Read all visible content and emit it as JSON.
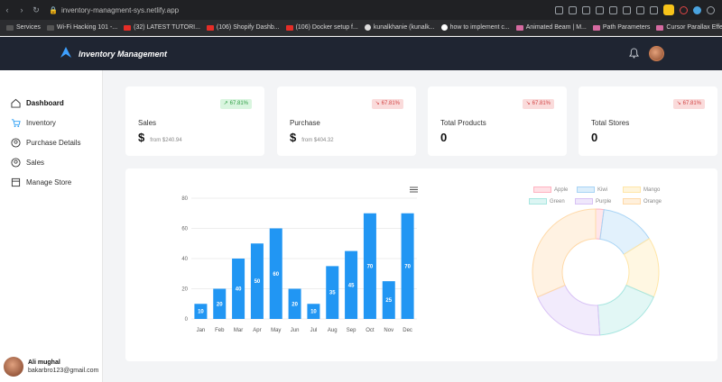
{
  "browser": {
    "url": "inventory-managment-sys.netlify.app"
  },
  "bookmarks": [
    {
      "label": "Services",
      "icon": "grid-icon"
    },
    {
      "label": "Wi-Fi Hacking 101 -...",
      "icon": "wifi-icon"
    },
    {
      "label": "(32) LATEST TUTORI...",
      "icon": "youtube-icon"
    },
    {
      "label": "(106) Shopify Dashb...",
      "icon": "youtube-icon"
    },
    {
      "label": "(106) Docker setup f...",
      "icon": "youtube-icon"
    },
    {
      "label": "kunalkhanie (kunalk...",
      "icon": "github-icon"
    },
    {
      "label": "how to implement c...",
      "icon": "google-icon"
    },
    {
      "label": "Animated Beam | M...",
      "icon": "app-icon"
    },
    {
      "label": "Path Parameters",
      "icon": "app-icon"
    },
    {
      "label": "Cursor Parallax Effect",
      "icon": "app-icon"
    }
  ],
  "header": {
    "title": "Inventory Management"
  },
  "sidebar": {
    "items": [
      {
        "label": "Dashboard",
        "icon": "home-icon",
        "active": true
      },
      {
        "label": "Inventory",
        "icon": "cart-icon"
      },
      {
        "label": "Purchase Details",
        "icon": "user-icon"
      },
      {
        "label": "Sales",
        "icon": "user-icon"
      },
      {
        "label": "Manage Store",
        "icon": "store-icon"
      }
    ],
    "user": {
      "name": "Ali mughal",
      "email": "bakarbro123@gmail.com"
    }
  },
  "cards": [
    {
      "label": "Sales",
      "value": "$",
      "sub": "from $240.94",
      "badge": "67.81%",
      "trend": "up"
    },
    {
      "label": "Purchase",
      "value": "$",
      "sub": "from $404.32",
      "badge": "67.81%",
      "trend": "down"
    },
    {
      "label": "Total Products",
      "value": "0",
      "sub": "",
      "badge": "67.81%",
      "trend": "down"
    },
    {
      "label": "Total Stores",
      "value": "0",
      "sub": "",
      "badge": "67.81%",
      "trend": "down"
    }
  ],
  "colors": {
    "header_bg": "#1f2532",
    "bar": "#2196f3",
    "badge_up": "#2f9e44",
    "badge_down": "#d24545"
  },
  "chart_data": [
    {
      "type": "bar",
      "categories": [
        "Jan",
        "Feb",
        "Mar",
        "Apr",
        "May",
        "Jun",
        "Jul",
        "Aug",
        "Sep",
        "Oct",
        "Nov",
        "Dec"
      ],
      "values": [
        10,
        20,
        40,
        50,
        60,
        20,
        10,
        35,
        45,
        70,
        25,
        70
      ],
      "yticks": [
        0,
        20,
        40,
        60,
        80
      ],
      "ylim": [
        0,
        80
      ],
      "grid": true
    },
    {
      "type": "pie",
      "donut": true,
      "labels": [
        "Apple",
        "Kiwi",
        "Mango",
        "Green",
        "Purple",
        "Orange"
      ],
      "values": [
        3,
        20,
        22,
        25,
        28,
        45
      ],
      "colors": [
        "#ffb3c1",
        "#a8d4f5",
        "#ffe6a8",
        "#a8e6e0",
        "#d8c2f5",
        "#ffd9a8"
      ],
      "legend": "top"
    }
  ]
}
